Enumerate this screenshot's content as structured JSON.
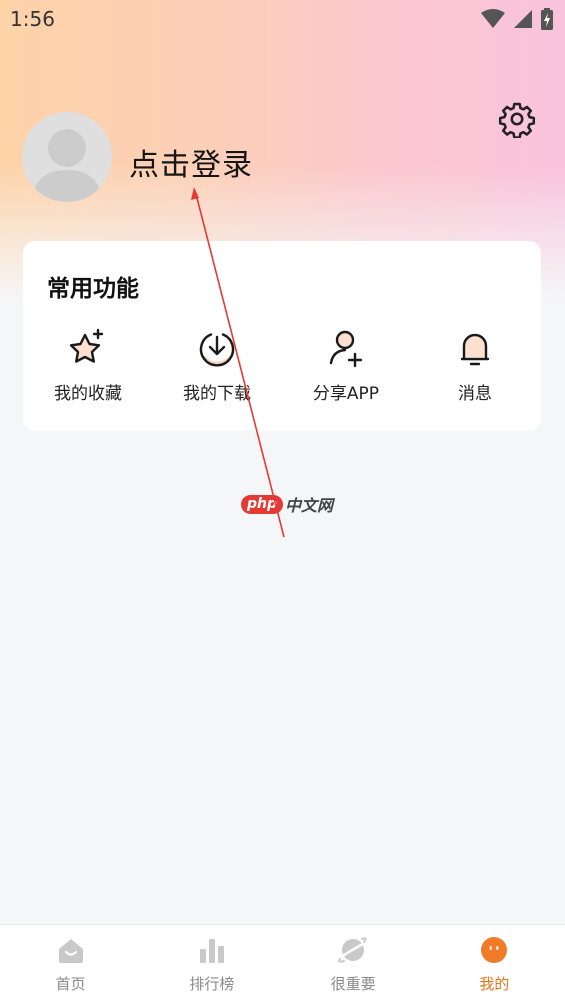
{
  "status_bar": {
    "time": "1:56",
    "icons": [
      "wifi-icon",
      "signal-icon",
      "battery-icon"
    ]
  },
  "profile": {
    "login_label": "点击登录",
    "avatar_icon": "avatar-placeholder-icon",
    "settings_icon": "gear-icon"
  },
  "common_functions": {
    "title": "常用功能",
    "items": [
      {
        "label": "我的收藏",
        "icon": "star-sparkle-icon"
      },
      {
        "label": "我的下载",
        "icon": "download-icon"
      },
      {
        "label": "分享APP",
        "icon": "add-user-icon"
      },
      {
        "label": "消息",
        "icon": "bell-icon"
      }
    ]
  },
  "watermark": {
    "brand": "php",
    "suffix": "中文网"
  },
  "tab_bar": {
    "items": [
      {
        "label": "首页",
        "icon": "home-icon",
        "active": false
      },
      {
        "label": "排行榜",
        "icon": "bar-chart-icon",
        "active": false
      },
      {
        "label": "很重要",
        "icon": "planet-icon",
        "active": false
      },
      {
        "label": "我的",
        "icon": "face-icon",
        "active": true
      }
    ]
  },
  "colors": {
    "accent": "#e8741d",
    "inactive_tab": "#8a8a8a",
    "annotation_arrow": "#e53935",
    "watermark_badge": "#e53935"
  }
}
